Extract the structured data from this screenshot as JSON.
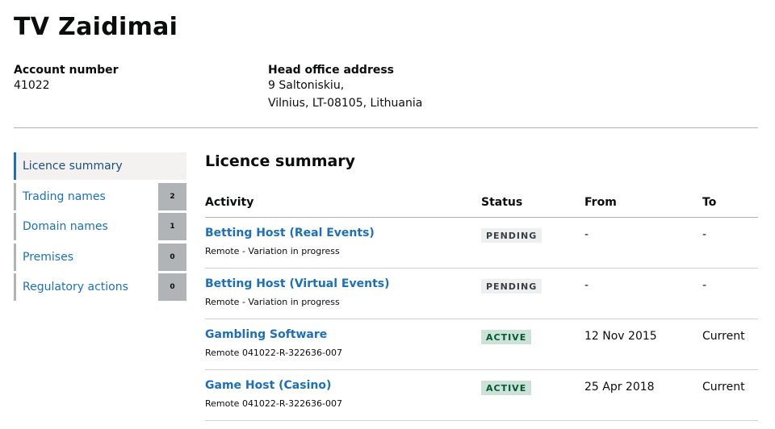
{
  "page": {
    "title": "TV Zaidimai"
  },
  "account": {
    "number_label": "Account number",
    "number_value": "41022",
    "address_label": "Head office address",
    "address_line1": "9 Saltoniskiu,",
    "address_line2": "Vilnius, LT-08105, Lithuania"
  },
  "sidebar": {
    "items": [
      {
        "label": "Licence summary",
        "count": "",
        "active": true
      },
      {
        "label": "Trading names",
        "count": "2",
        "active": false
      },
      {
        "label": "Domain names",
        "count": "1",
        "active": false
      },
      {
        "label": "Premises",
        "count": "0",
        "active": false
      },
      {
        "label": "Regulatory actions",
        "count": "0",
        "active": false
      }
    ]
  },
  "main": {
    "section_title": "Licence summary",
    "columns": [
      "Activity",
      "Status",
      "From",
      "To"
    ],
    "rows": [
      {
        "activity": "Betting Host (Real Events)",
        "detail": "Remote - Variation in progress",
        "status": "PENDING",
        "status_type": "pending",
        "from": "-",
        "to": "-"
      },
      {
        "activity": "Betting Host (Virtual Events)",
        "detail": "Remote - Variation in progress",
        "status": "PENDING",
        "status_type": "pending",
        "from": "-",
        "to": "-"
      },
      {
        "activity": "Gambling Software",
        "detail": "Remote 041022-R-322636-007",
        "status": "ACTIVE",
        "status_type": "active",
        "from": "12 Nov 2015",
        "to": "Current"
      },
      {
        "activity": "Game Host (Casino)",
        "detail": "Remote 041022-R-322636-007",
        "status": "ACTIVE",
        "status_type": "active",
        "from": "25 Apr 2018",
        "to": "Current"
      }
    ]
  },
  "colors": {
    "link": "#1d70b8",
    "active_tag_bg": "#cce2d8",
    "active_tag_text": "#005a30",
    "pending_tag_bg": "#eeefef",
    "count_bg": "#b1b4b6"
  }
}
